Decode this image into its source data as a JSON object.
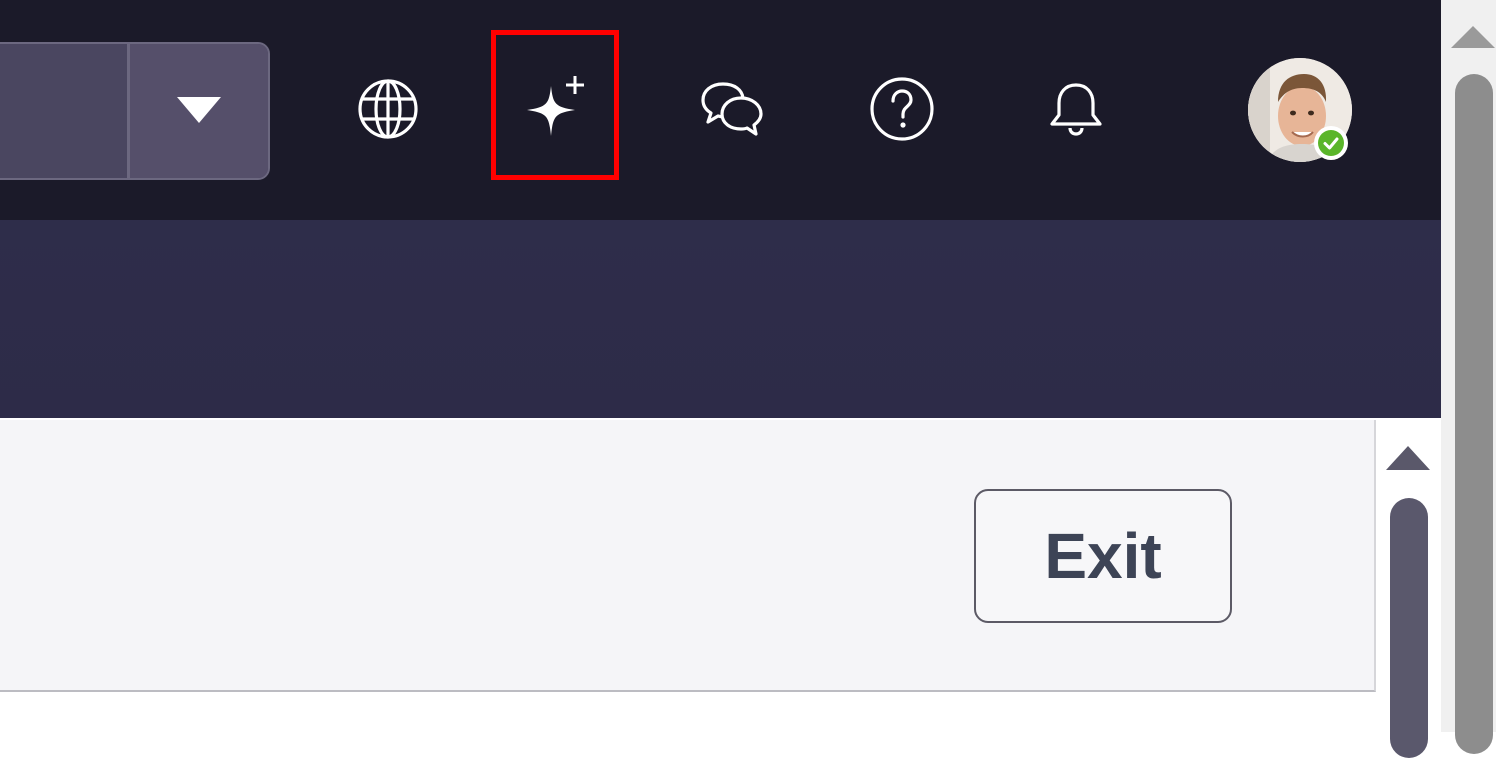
{
  "header": {
    "split_button": {
      "label": "",
      "caret_icon": "caret-down-icon"
    },
    "icons": [
      {
        "name": "globe-icon",
        "purpose": "language"
      },
      {
        "name": "sparkle-icon",
        "purpose": "ai-assistant",
        "highlighted": true
      },
      {
        "name": "chat-bubbles-icon",
        "purpose": "messages"
      },
      {
        "name": "help-icon",
        "purpose": "help"
      },
      {
        "name": "bell-icon",
        "purpose": "notifications"
      }
    ],
    "avatar": {
      "status": "online",
      "status_color": "#5ab52a"
    },
    "highlight_color": "#ff0000"
  },
  "panel": {
    "exit_label": "Exit"
  },
  "colors": {
    "topbar": "#1b1a29",
    "subbar": "#2e2d4a",
    "panel": "#f5f5f8",
    "exit_text": "#3d4456"
  }
}
